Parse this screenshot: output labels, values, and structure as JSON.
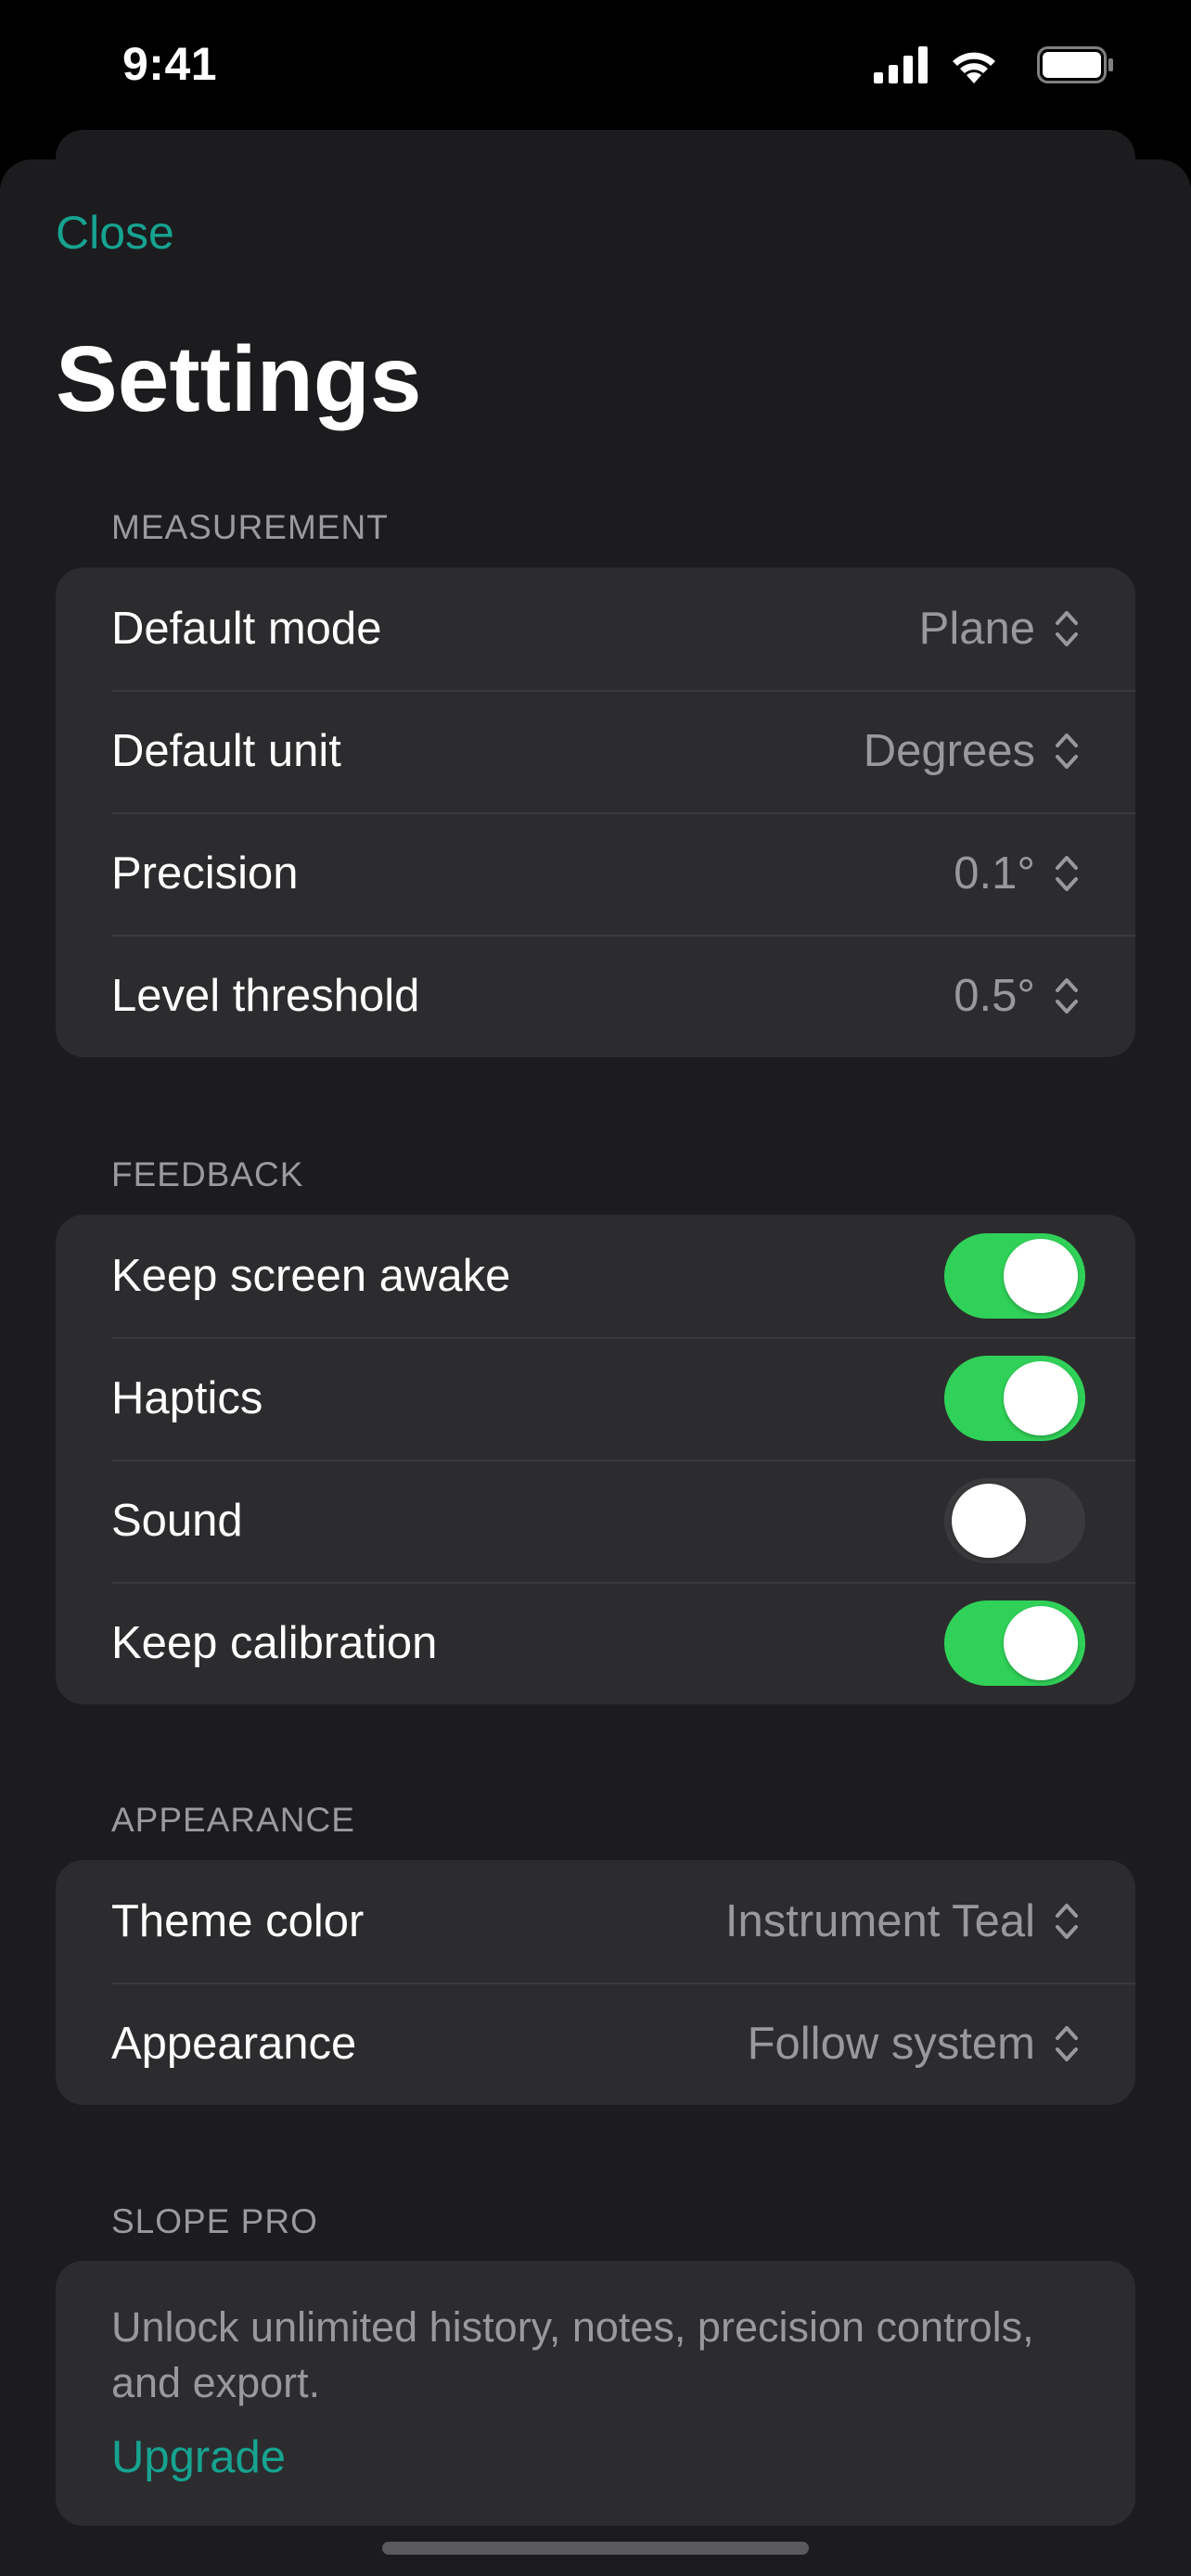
{
  "status_bar": {
    "time": "9:41"
  },
  "header": {
    "close_label": "Close",
    "title": "Settings"
  },
  "sections": {
    "measurement": {
      "header": "MEASUREMENT",
      "rows": [
        {
          "label": "Default mode",
          "value": "Plane"
        },
        {
          "label": "Default unit",
          "value": "Degrees"
        },
        {
          "label": "Precision",
          "value": "0.1°"
        },
        {
          "label": "Level threshold",
          "value": "0.5°"
        }
      ]
    },
    "feedback": {
      "header": "FEEDBACK",
      "rows": [
        {
          "label": "Keep screen awake",
          "on": true
        },
        {
          "label": "Haptics",
          "on": true
        },
        {
          "label": "Sound",
          "on": false
        },
        {
          "label": "Keep calibration",
          "on": true
        }
      ]
    },
    "appearance": {
      "header": "APPEARANCE",
      "rows": [
        {
          "label": "Theme color",
          "value": "Instrument Teal"
        },
        {
          "label": "Appearance",
          "value": "Follow system"
        }
      ]
    },
    "pro": {
      "header": "SLOPE PRO",
      "description": "Unlock unlimited history, notes, precision controls, and export.",
      "upgrade_label": "Upgrade"
    }
  },
  "icons": {
    "signal": "cellular-signal-icon",
    "wifi": "wifi-icon",
    "battery": "battery-icon",
    "chevron": "up-down-chevron-icon"
  },
  "colors": {
    "accent": "#16a390",
    "toggle_on": "#30d158",
    "toggle_off": "#3a3a3c",
    "sheet_bg": "#1c1c1e",
    "group_bg": "#2c2c2e",
    "secondary_text": "#98989d"
  }
}
